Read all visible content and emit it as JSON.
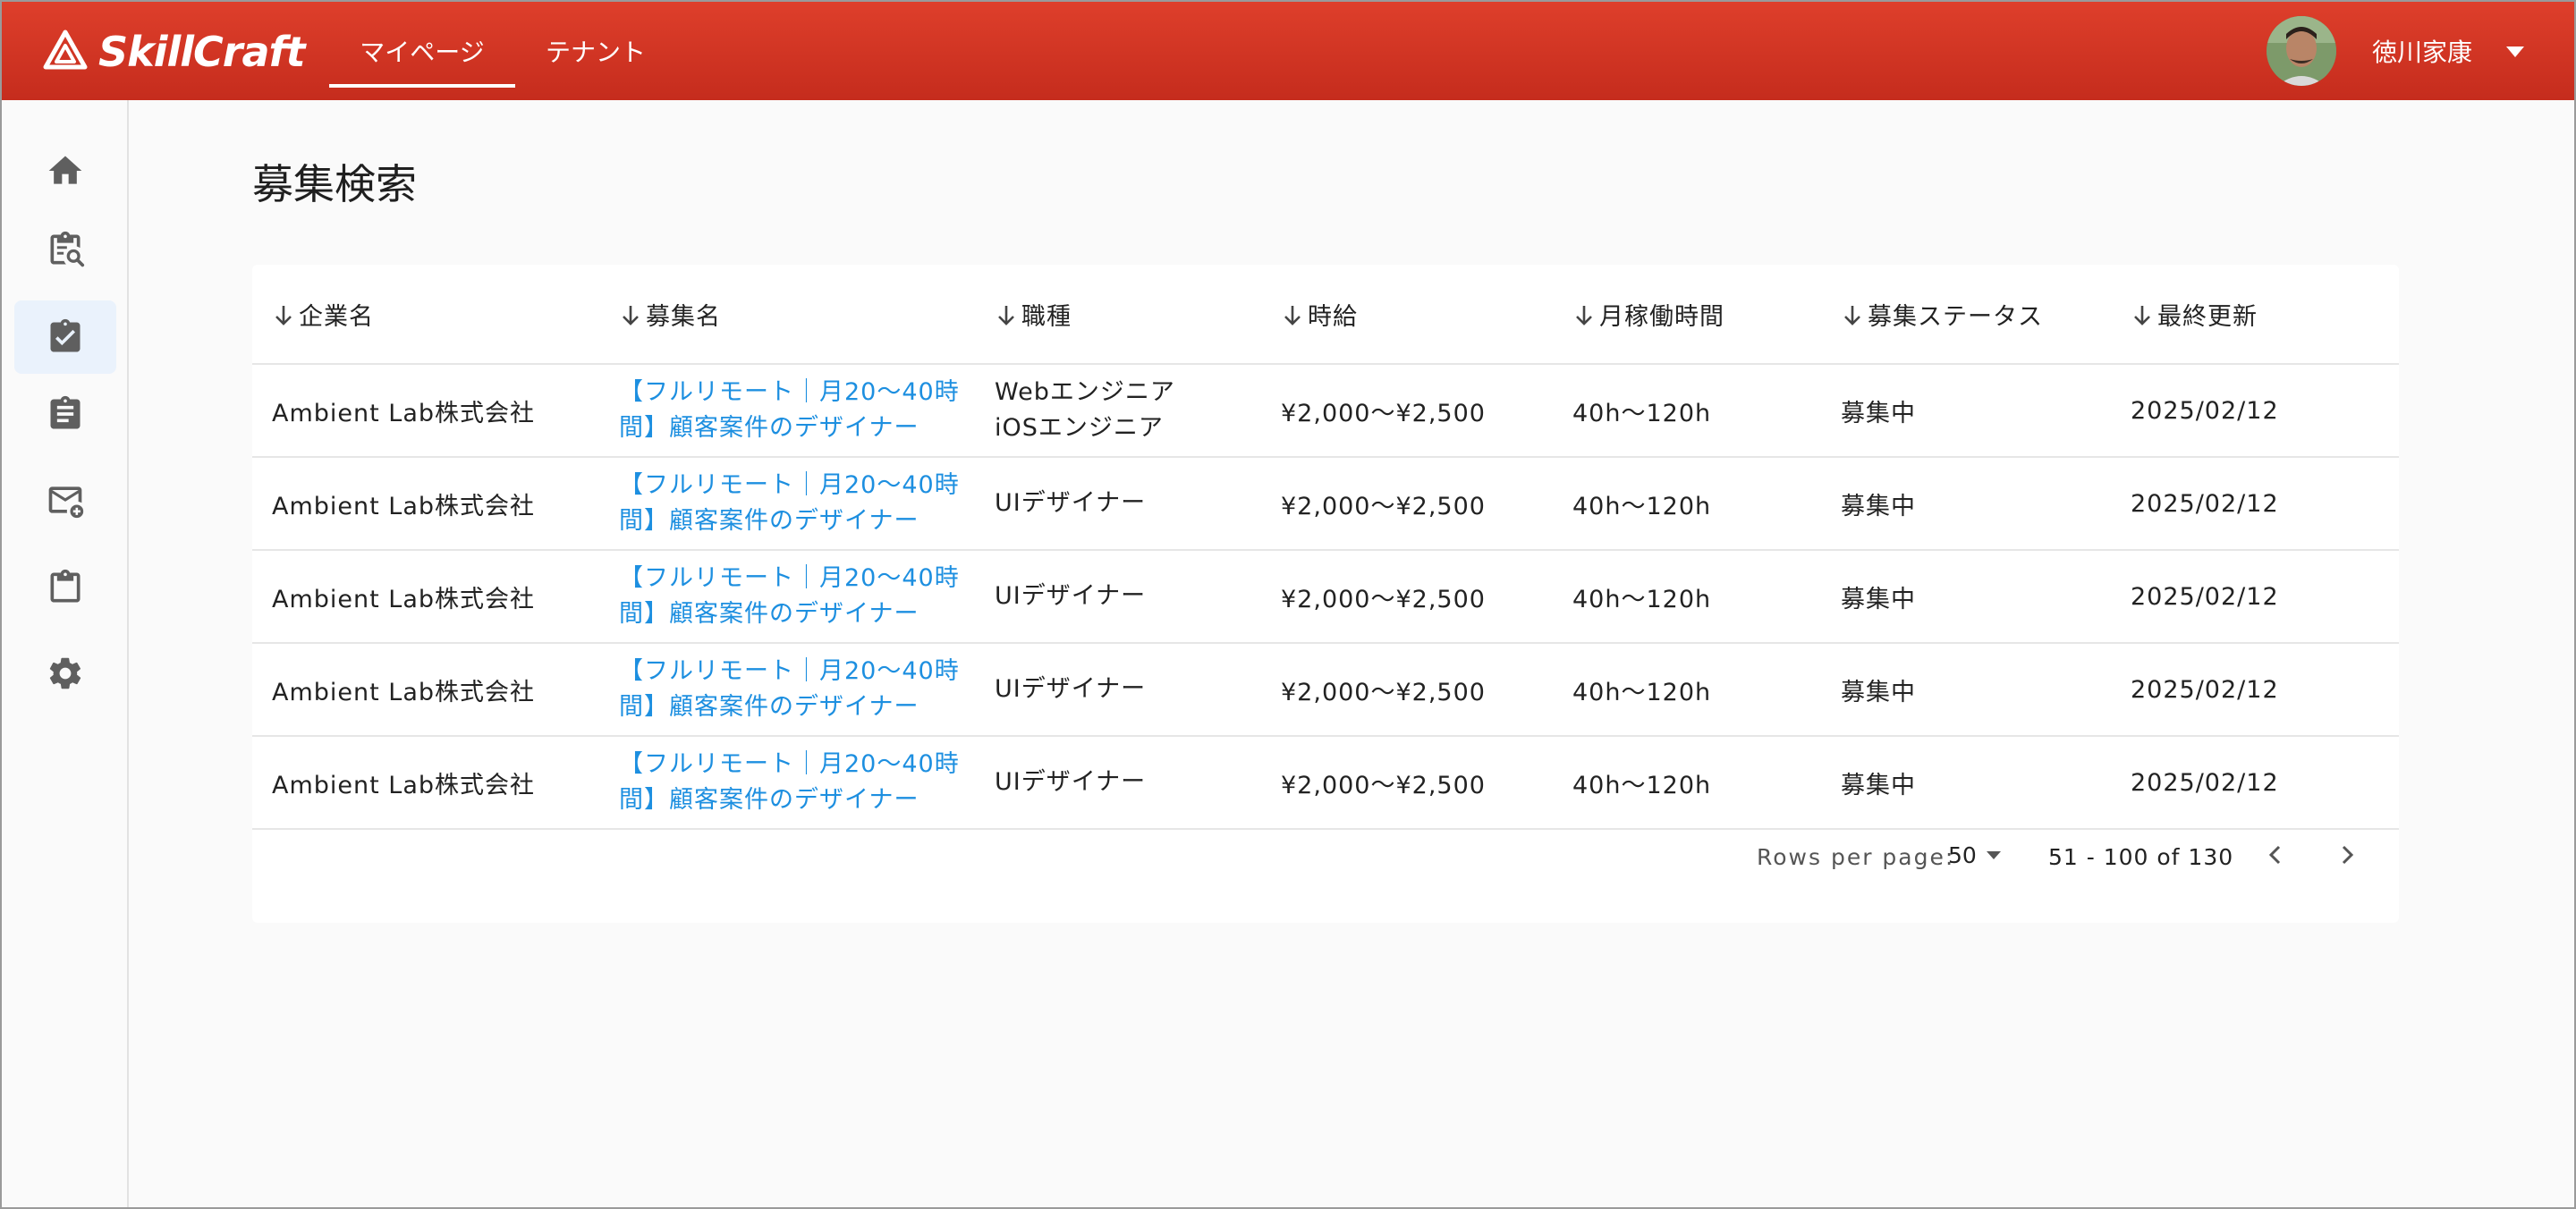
{
  "header": {
    "logo_text": "SkillCraft",
    "tabs": [
      {
        "label": "マイページ",
        "active": true
      },
      {
        "label": "テナント",
        "active": false
      }
    ],
    "user_name": "徳川家康"
  },
  "sidebar": {
    "items": [
      {
        "icon": "home-icon",
        "active": false
      },
      {
        "icon": "clipboard-search-icon",
        "active": false
      },
      {
        "icon": "clipboard-check-icon",
        "active": true
      },
      {
        "icon": "clipboard-text-icon",
        "active": false
      },
      {
        "icon": "mail-add-icon",
        "active": false
      },
      {
        "icon": "clipboard-icon",
        "active": false
      },
      {
        "icon": "gear-icon",
        "active": false
      }
    ]
  },
  "page": {
    "title": "募集検索"
  },
  "table": {
    "columns": [
      "企業名",
      "募集名",
      "職種",
      "時給",
      "月稼働時間",
      "募集ステータス",
      "最終更新"
    ],
    "rows": [
      {
        "company": "Ambient Lab株式会社",
        "title": "【フルリモート｜月20〜40時間】顧客案件のデザイナー",
        "job_type_1": "Webエンジニア",
        "job_type_2": "iOSエンジニア",
        "wage": "¥2,000〜¥2,500",
        "hours": "40h〜120h",
        "status": "募集中",
        "updated": "2025/02/12"
      },
      {
        "company": "Ambient Lab株式会社",
        "title": "【フルリモート｜月20〜40時間】顧客案件のデザイナー",
        "job_type_1": "UIデザイナー",
        "job_type_2": "",
        "wage": "¥2,000〜¥2,500",
        "hours": "40h〜120h",
        "status": "募集中",
        "updated": "2025/02/12"
      },
      {
        "company": "Ambient Lab株式会社",
        "title": "【フルリモート｜月20〜40時間】顧客案件のデザイナー",
        "job_type_1": "UIデザイナー",
        "job_type_2": "",
        "wage": "¥2,000〜¥2,500",
        "hours": "40h〜120h",
        "status": "募集中",
        "updated": "2025/02/12"
      },
      {
        "company": "Ambient Lab株式会社",
        "title": "【フルリモート｜月20〜40時間】顧客案件のデザイナー",
        "job_type_1": "UIデザイナー",
        "job_type_2": "",
        "wage": "¥2,000〜¥2,500",
        "hours": "40h〜120h",
        "status": "募集中",
        "updated": "2025/02/12"
      },
      {
        "company": "Ambient Lab株式会社",
        "title": "【フルリモート｜月20〜40時間】顧客案件のデザイナー",
        "job_type_1": "UIデザイナー",
        "job_type_2": "",
        "wage": "¥2,000〜¥2,500",
        "hours": "40h〜120h",
        "status": "募集中",
        "updated": "2025/02/12"
      }
    ]
  },
  "pagination": {
    "rows_per_page_label": "Rows per page:",
    "rows_per_page_value": "50",
    "range_text": "51 - 100 of 130"
  },
  "colors": {
    "header_red": "#d33a26",
    "link_blue": "#1d8fe0",
    "active_sidebar_bg": "#eaf2fc",
    "icon_grey": "#5f5f5f"
  }
}
